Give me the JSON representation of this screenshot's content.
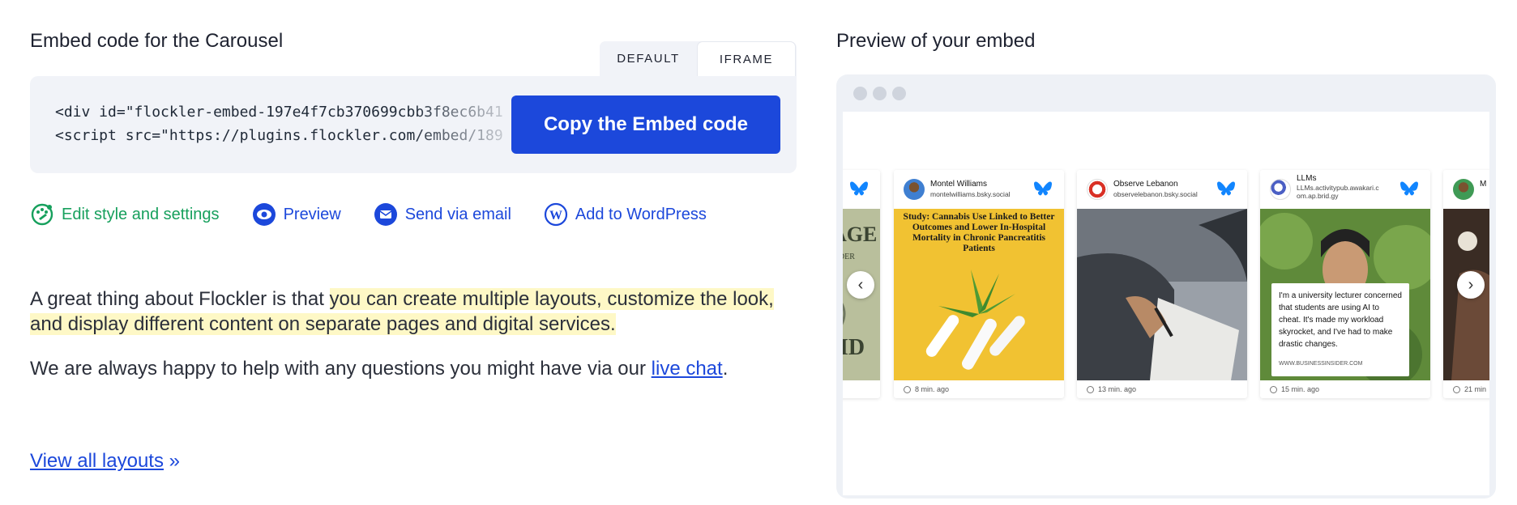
{
  "left": {
    "title": "Embed code for the Carousel",
    "tabs": [
      {
        "label": "DEFAULT",
        "active": true
      },
      {
        "label": "IFRAME",
        "active": false
      }
    ],
    "code": {
      "line1": "<div id=\"flockler-embed-197e4f7cb370699cbb3f8ec6b41",
      "line2": "<script src=\"https://plugins.flockler.com/embed/189"
    },
    "copy_button": "Copy the Embed code",
    "actions": [
      {
        "label": "Edit style and settings",
        "icon": "palette-icon"
      },
      {
        "label": "Preview",
        "icon": "eye-icon"
      },
      {
        "label": "Send via email",
        "icon": "envelope-icon"
      },
      {
        "label": "Add to WordPress",
        "icon": "wordpress-icon"
      }
    ],
    "paragraph1": {
      "plain": "A great thing about Flockler is that ",
      "highlight": "you can create multiple layouts, customize the look, and display different content on separate pages and digital services."
    },
    "paragraph2": {
      "before": "We are always happy to help with any questions you might have via our ",
      "link": "live chat",
      "after": "."
    },
    "view_all": {
      "link": "View all layouts",
      "suffix": "»"
    }
  },
  "right": {
    "title": "Preview of your embed",
    "cards": [
      {
        "author": "",
        "handle": "",
        "time": "",
        "image": "dollar-bill"
      },
      {
        "author": "Montel Williams",
        "handle": "montelwilliams.bsky.social",
        "time": "8 min. ago",
        "image": "cannabis",
        "image_text": "Study: Cannabis Use Linked to Better Outcomes and Lower In-Hospital Mortality in Chronic Pancreatitis Patients"
      },
      {
        "author": "Observe Lebanon",
        "handle": "observelebanon.bsky.social",
        "time": "13 min. ago",
        "image": "students-writing"
      },
      {
        "author": "LLMs",
        "handle": "LLMs.activitypub.awakari.c om.ap.brid.gy",
        "time": "15 min. ago",
        "image": "lecturer",
        "quote": "I'm a university lecturer concerned that students are using AI to cheat. It's made my workload skyrocket, and I've had to make drastic changes.",
        "source": "WWW.BUSINESSINSIDER.COM"
      },
      {
        "author": "M",
        "handle": "",
        "time": "21 min",
        "image": "partial"
      }
    ],
    "colors": {
      "accent_blue": "#1c48db",
      "green": "#17a05d",
      "bluesky": "#1185fe"
    }
  }
}
